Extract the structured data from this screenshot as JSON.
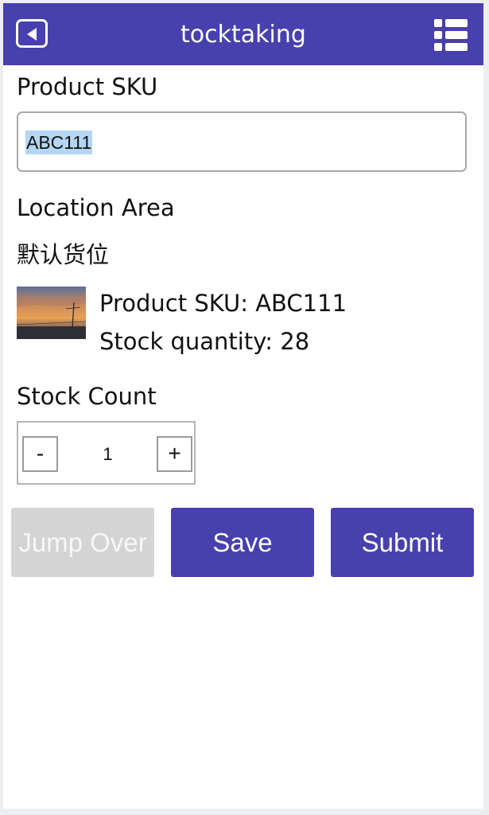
{
  "header": {
    "title": "tocktaking",
    "back_icon": "back-arrow-icon",
    "menu_icon": "list-menu-icon"
  },
  "sku": {
    "label": "Product SKU",
    "value": "ABC111"
  },
  "location": {
    "label": "Location Area",
    "value": "默认货位"
  },
  "product": {
    "image": "sunset-photo",
    "sku_line": "Product SKU: ABC111",
    "qty_line": "Stock quantity: 28"
  },
  "count": {
    "label": "Stock Count",
    "minus": "-",
    "plus": "+",
    "value": "1"
  },
  "actions": {
    "skip_label": "Jump Over",
    "save_label": "Save",
    "submit_label": "Submit"
  },
  "colors": {
    "primary": "#4840ac",
    "disabled": "#d4d4d4",
    "selection": "#b3d7f3"
  }
}
